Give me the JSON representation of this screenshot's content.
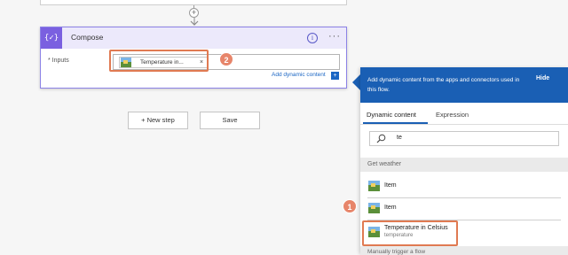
{
  "compose": {
    "icon": "compose-braces-icon",
    "icon_glyph": "{✓}",
    "title": "Compose",
    "inputs_label": "* Inputs",
    "token_label": "Temperature in...",
    "token_close": "×",
    "add_dynamic": "Add dynamic content",
    "more_glyph": "···",
    "info_glyph": "i"
  },
  "connector": {
    "plus_glyph": "+"
  },
  "buttons": {
    "new_step": "+ New step",
    "save": "Save"
  },
  "badges": {
    "one": "1",
    "two": "2"
  },
  "panel": {
    "header_text": "Add dynamic content from the apps and connectors used in this flow.",
    "hide": "Hide",
    "tabs": [
      "Dynamic content",
      "Expression"
    ],
    "active_tab": "Dynamic content",
    "search_value": "te",
    "section": "Get weather",
    "items": [
      {
        "label": "Item"
      },
      {
        "label": "Item"
      },
      {
        "label": "Temperature in Celsius",
        "sub": "temperature"
      }
    ],
    "next_section": "Manually trigger a flow"
  },
  "colors": {
    "accent_purple": "#7a60e0",
    "panel_blue": "#1a5fb4",
    "highlight_orange": "#e07a52",
    "link_blue": "#1a66c4"
  }
}
